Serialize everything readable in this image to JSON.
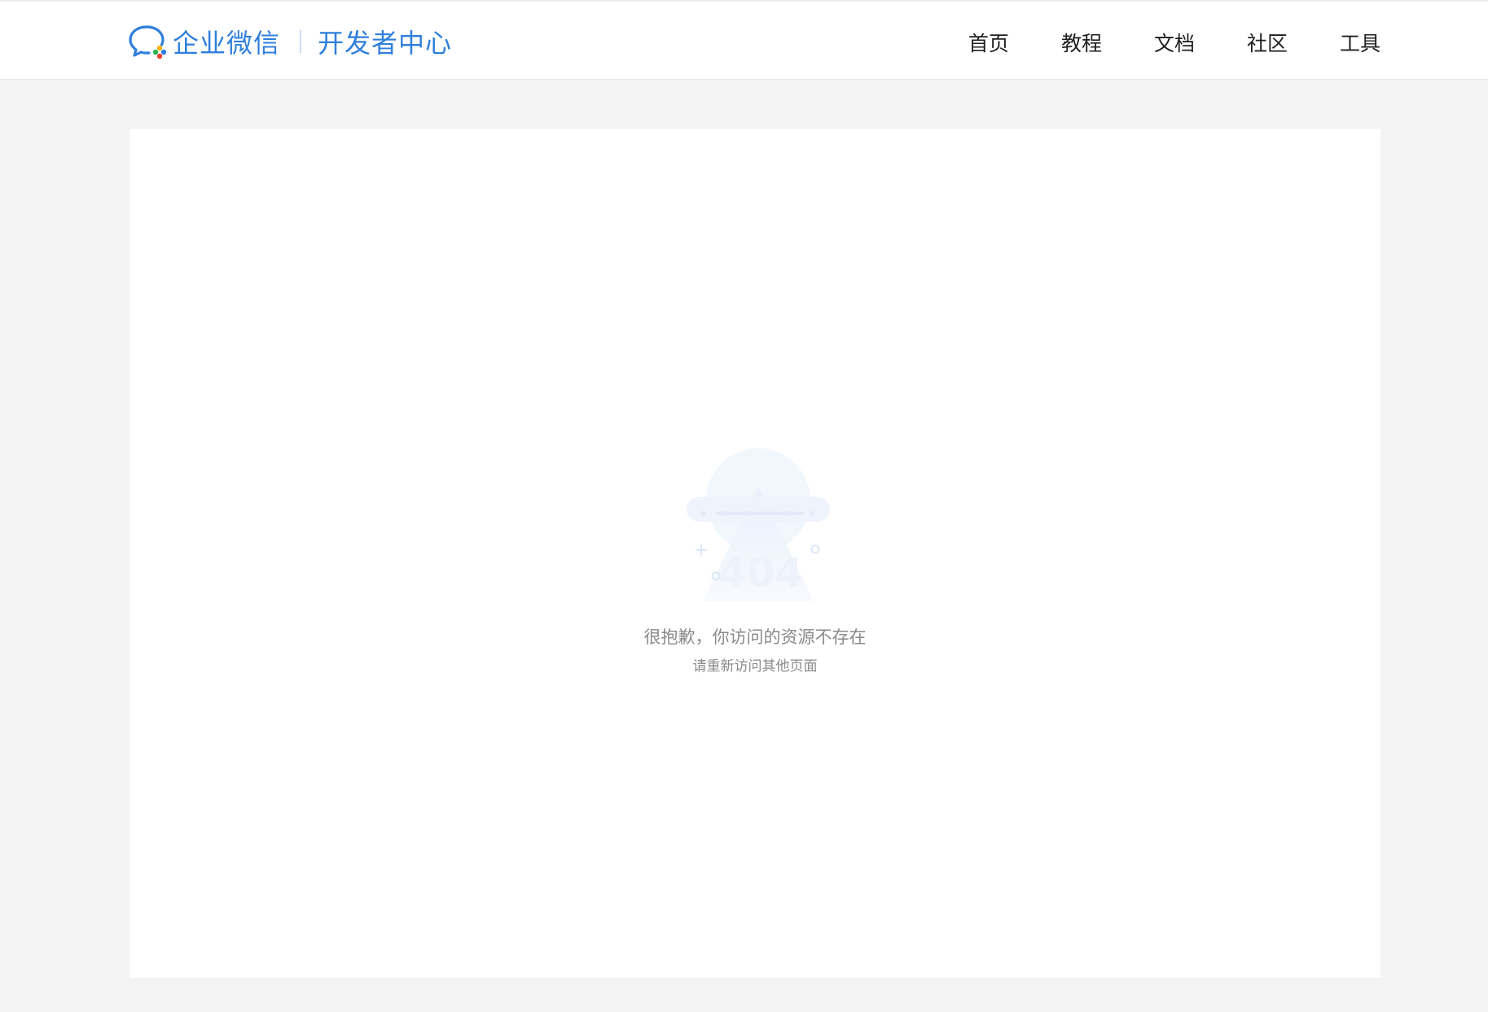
{
  "header": {
    "brand_name": "企业微信",
    "brand_sub": "开发者中心",
    "nav": [
      "首页",
      "教程",
      "文档",
      "社区",
      "工具"
    ]
  },
  "error": {
    "code": "404",
    "message": "很抱歉，你访问的资源不存在",
    "hint": "请重新访问其他页面"
  },
  "colors": {
    "brand": "#2f7fdc",
    "page_bg": "#f3f3f3",
    "text_muted": "#8a8a8a"
  },
  "icons": [
    "wecom-logo-icon",
    "404-illustration"
  ]
}
